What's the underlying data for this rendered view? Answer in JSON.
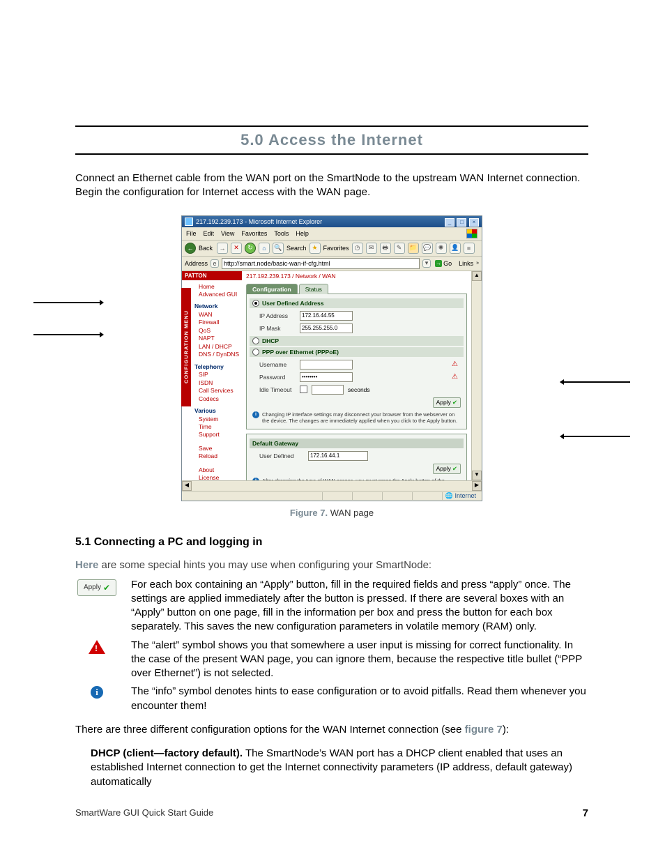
{
  "chapter": {
    "title": "5.0  Access the Internet"
  },
  "intro": "Connect an Ethernet cable from the WAN port on the SmartNode to the upstream WAN Internet connection. Begin the configuration for Internet access with the WAN page.",
  "browser": {
    "title": "217.192.239.173 - Microsoft Internet Explorer",
    "menus": {
      "file": "File",
      "edit": "Edit",
      "view": "View",
      "favorites": "Favorites",
      "tools": "Tools",
      "help": "Help"
    },
    "toolbar": {
      "back": "Back",
      "search": "Search",
      "favorites": "Favorites"
    },
    "address_label": "Address",
    "url": "http://smart.node/basic-wan-if-cfg.html",
    "go": "Go",
    "links": "Links",
    "status_internet": "Internet"
  },
  "sidebar": {
    "brand": "PATTON",
    "band": "CONFIGURATION MENU",
    "home": "Home",
    "advanced": "Advanced GUI",
    "network_head": "Network",
    "network": {
      "wan": "WAN",
      "firewall": "Firewall",
      "qos": "QoS",
      "napt": "NAPT",
      "landhcp": "LAN / DHCP",
      "dns": "DNS / DynDNS"
    },
    "telephony_head": "Telephony",
    "telephony": {
      "sip": "SIP",
      "isdn": "ISDN",
      "callsvc": "Call Services",
      "codecs": "Codecs"
    },
    "various_head": "Various",
    "various": {
      "system": "System",
      "time": "Time",
      "support": "Support"
    },
    "save": "Save",
    "reload": "Reload",
    "about": "About",
    "license": "License"
  },
  "wanpage": {
    "breadcrumb": "217.192.239.173 / Network / WAN",
    "tab_config": "Configuration",
    "tab_status": "Status",
    "sec_user": "User Defined Address",
    "ip_label": "IP Address",
    "ip_value": "172.16.44.55",
    "mask_label": "IP Mask",
    "mask_value": "255.255.255.0",
    "sec_dhcp": "DHCP",
    "sec_pppoe": "PPP over Ethernet (PPPoE)",
    "user_label": "Username",
    "user_value": "",
    "pass_label": "Password",
    "pass_value": "••••••••",
    "idle_label": "Idle Timeout",
    "idle_unit": "seconds",
    "apply": "Apply",
    "info1": "Changing IP interface settings may disconnect your browser from the webserver on the device. The changes are immediately applied when you click to the Apply button.",
    "gw_head": "Default Gateway",
    "gw_label": "User Defined",
    "gw_value": "172.16.44.1",
    "info2": "After changing the type of WAN access, you must press the Apply button of the Default Gateway even if you need not enter a Default Gateway (i.e. when it says 'Set via DHCP' or 'Set via PPPoE')."
  },
  "figure": {
    "label": "Figure 7.",
    "caption": "WAN page"
  },
  "section51": {
    "heading": "5.1  Connecting a PC and logging in",
    "lead_pre": "Here",
    "lead_post": " are some special hints you may use when configuring your SmartNode:",
    "apply_label": "Apply",
    "hint_apply": "For each box containing an “Apply” button, fill in the required fields and press “apply” once. The settings are applied immediately after the button is pressed. If there are several boxes with an “Apply” button on one page, fill in the information per box and press the button for each box separately.  This saves the new configuration parameters in volatile memory (RAM) only.",
    "hint_alert": "The “alert” symbol shows you that somewhere a user input is missing for correct functionality. In the case of the present WAN page, you can ignore them, because the respective title bullet (“PPP over Ethernet”) is not selected.",
    "hint_info": "The “info” symbol denotes hints to ease configuration or to avoid pitfalls. Read them whenever you encounter them!"
  },
  "closing": {
    "line1_pre": "There are three different configuration options for the WAN Internet connection (see ",
    "line1_ref": "figure 7",
    "line1_post": "):",
    "dhcp_head": "DHCP (client—factory default).",
    "dhcp_body": " The SmartNode’s WAN port has a DHCP client enabled that uses an established Internet connection to get the Internet connectivity parameters (IP address, default gateway) automatically"
  },
  "footer": {
    "left": "SmartWare GUI Quick Start Guide",
    "page": "7"
  }
}
